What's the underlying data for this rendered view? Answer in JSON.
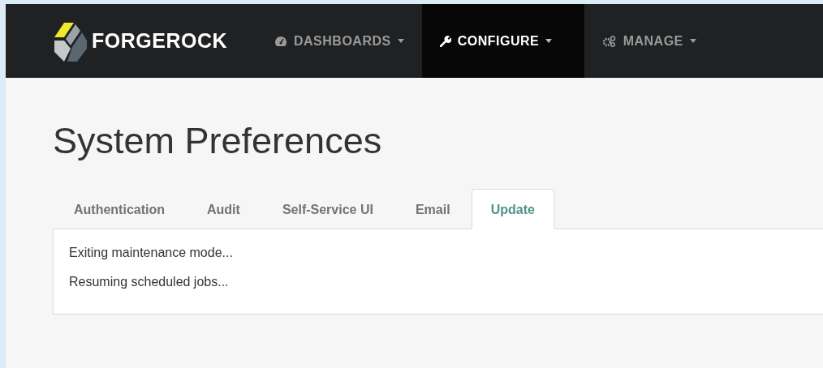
{
  "navbar": {
    "brand": "FORGEROCK",
    "menus": [
      {
        "label": "DASHBOARDS",
        "kind": "gauge",
        "selected": false
      },
      {
        "label": "CONFIGURE",
        "kind": "wrench",
        "selected": true
      },
      {
        "label": "MANAGE",
        "kind": "gears",
        "selected": false
      }
    ]
  },
  "page_title": "System Preferences",
  "tabs": [
    {
      "label": "Authentication",
      "selected": false
    },
    {
      "label": "Audit",
      "selected": false
    },
    {
      "label": "Self-Service UI",
      "selected": false
    },
    {
      "label": "Email",
      "selected": false
    },
    {
      "label": "Update",
      "selected": true
    }
  ],
  "messages": [
    "Exiting maintenance mode...",
    "Resuming scheduled jobs..."
  ]
}
